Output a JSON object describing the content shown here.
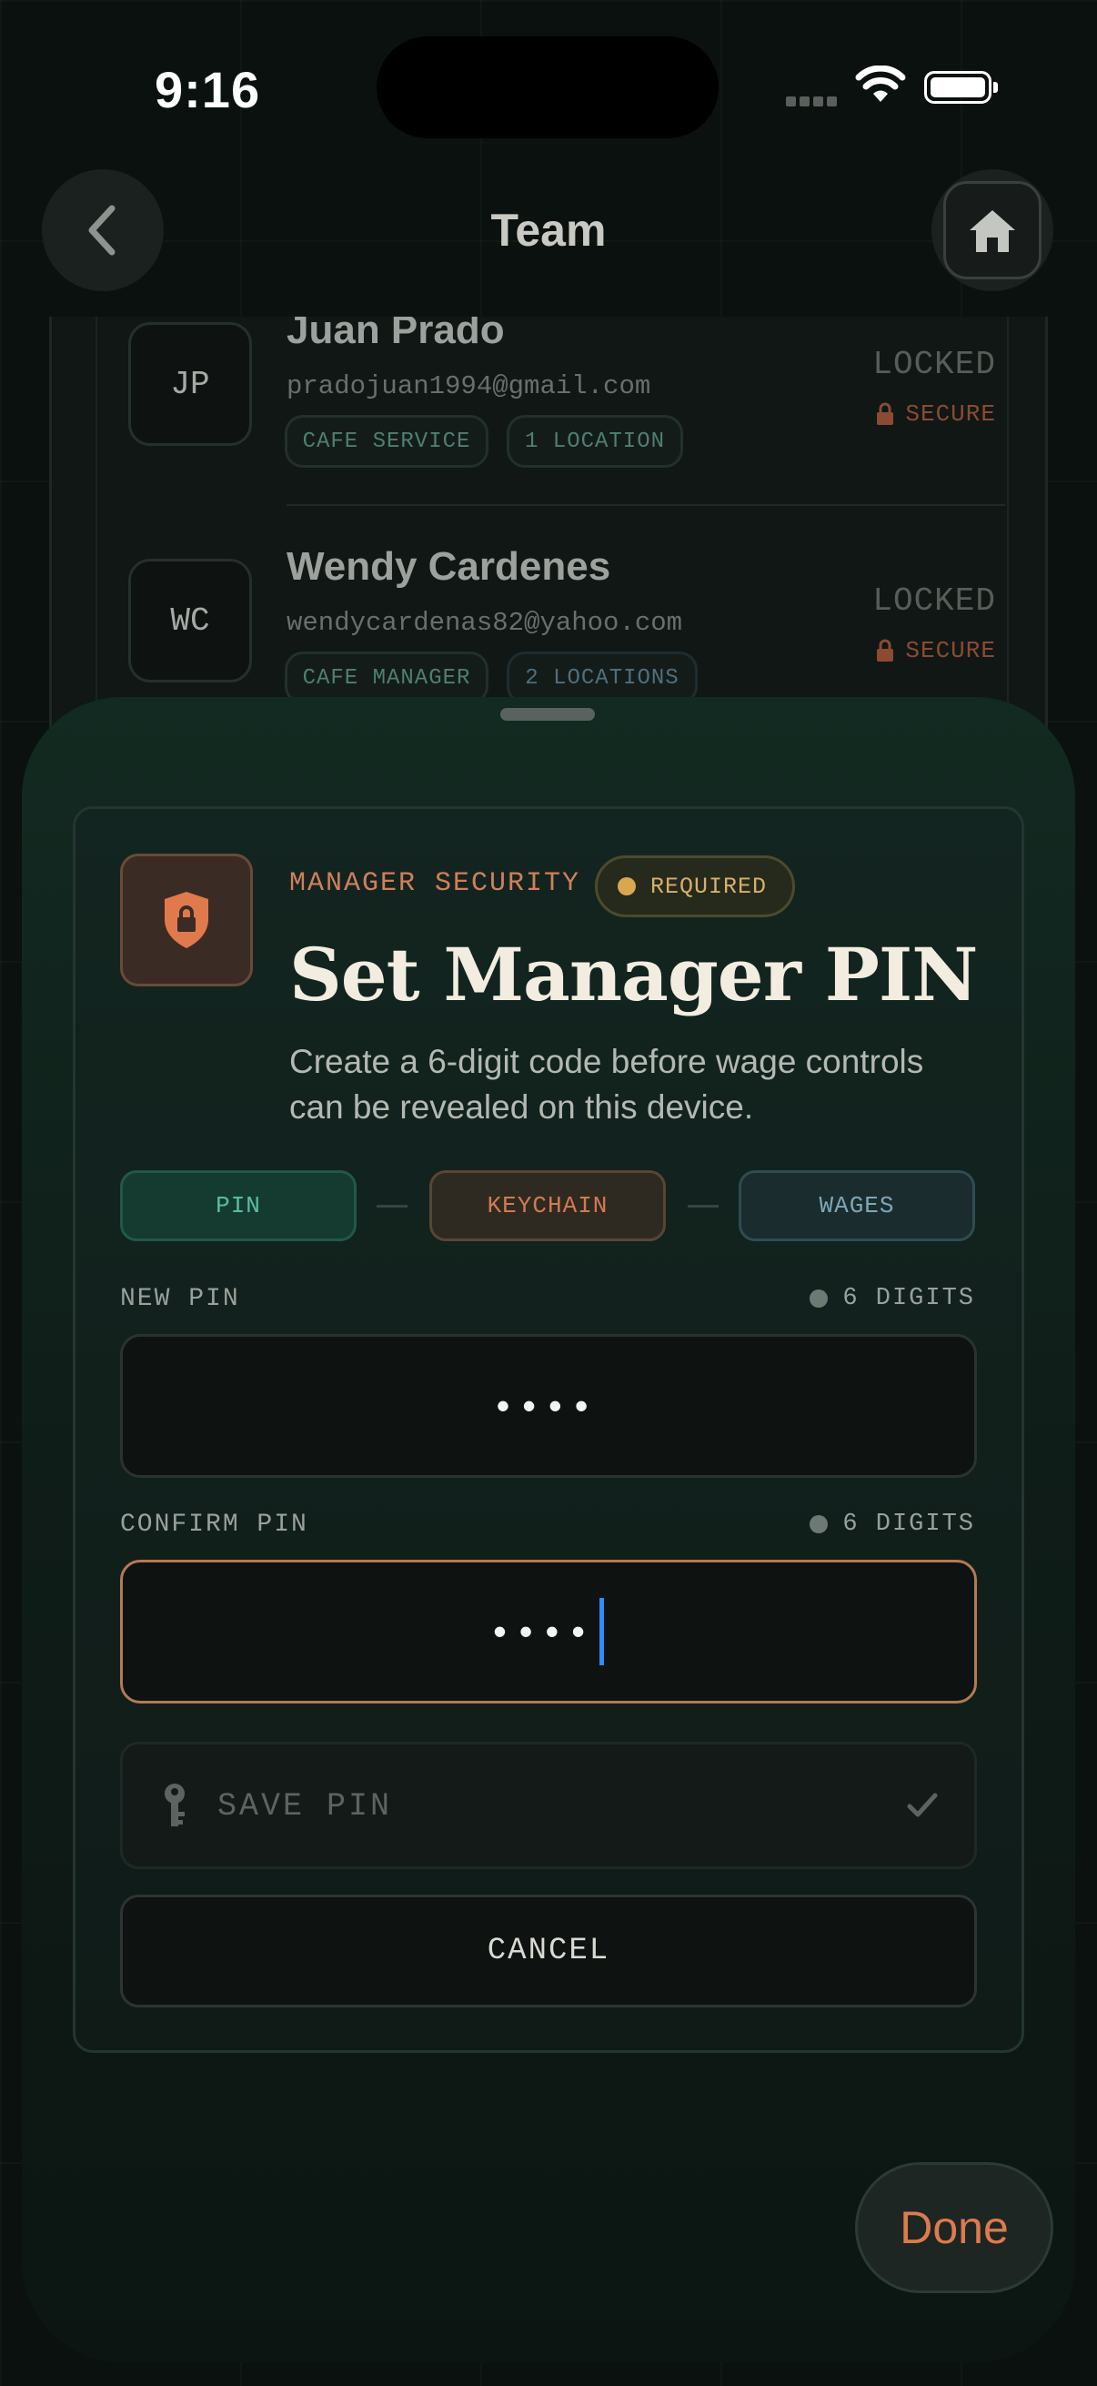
{
  "status_bar": {
    "time": "9:16"
  },
  "nav": {
    "title": "Team",
    "back_icon": "chevron-left-icon",
    "home_icon": "house-icon"
  },
  "members": [
    {
      "initials": "JP",
      "name": "Juan Prado",
      "email": "pradojuan1994@gmail.com",
      "chips": [
        "CAFE SERVICE",
        "1 LOCATION"
      ],
      "status": "LOCKED",
      "security": "SECURE"
    },
    {
      "initials": "WC",
      "name": "Wendy Cardenes",
      "email": "wendycardenas82@yahoo.com",
      "chips": [
        "CAFE MANAGER",
        "2 LOCATIONS"
      ],
      "status": "LOCKED",
      "security": "SECURE"
    }
  ],
  "sheet": {
    "kicker": "MANAGER SECURITY",
    "badge": "REQUIRED",
    "title": "Set Manager PIN",
    "subtitle": "Create a 6-digit code before wage controls can be revealed on this device.",
    "steps": [
      "PIN",
      "KEYCHAIN",
      "WAGES"
    ],
    "new_pin": {
      "label": "NEW PIN",
      "hint": "6 DIGITS",
      "value": "••••"
    },
    "confirm_pin": {
      "label": "CONFIRM PIN",
      "hint": "6 DIGITS",
      "value": "••••"
    },
    "save_label": "SAVE PIN",
    "cancel_label": "CANCEL"
  },
  "done_label": "Done",
  "colors": {
    "accent": "#de7a4e",
    "teal": "#5bbda3",
    "caret": "#2f8cff",
    "badge_dot": "#d9a750"
  }
}
